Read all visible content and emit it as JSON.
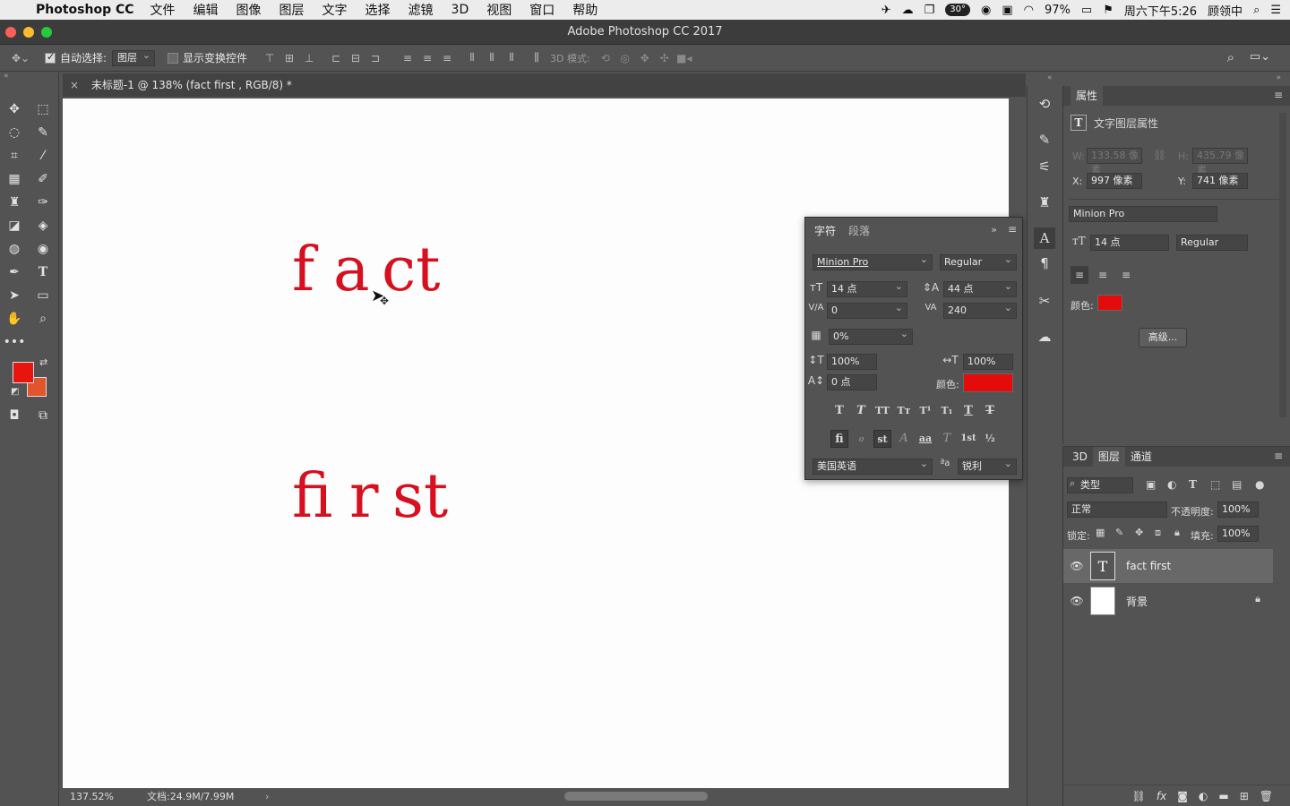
{
  "menubar": {
    "app_name": "Photoshop CC",
    "items": [
      "文件",
      "编辑",
      "图像",
      "图层",
      "文字",
      "选择",
      "滤镜",
      "3D",
      "视图",
      "窗口",
      "帮助"
    ],
    "temperature": "30°",
    "battery": "97%",
    "clock": "周六下午5:26",
    "user": "顾领中"
  },
  "window": {
    "title": "Adobe Photoshop CC 2017"
  },
  "options_bar": {
    "auto_select_label": "自动选择:",
    "auto_select_target": "图层",
    "show_transform_label": "显示变换控件",
    "mode_3d_label": "3D 模式:"
  },
  "document": {
    "tab_title": "未标题-1 @ 138% (fact first , RGB/8) *",
    "glyphs_line1": [
      "f",
      "a",
      "ct"
    ],
    "glyphs_line2": [
      "fi",
      "r",
      "st"
    ],
    "zoom": "137.52%",
    "doc_size": "文档:24.9M/7.99M"
  },
  "colors": {
    "foreground": "#e8150e",
    "background": "#e0552b",
    "text_color": "#e40b0b"
  },
  "properties_panel": {
    "tab": "属性",
    "section_title": "文字图层属性",
    "w_label": "W:",
    "w_value": "133.58 像素",
    "h_label": "H:",
    "h_value": "435.79 像素",
    "x_label": "X:",
    "x_value": "997 像素",
    "y_label": "Y:",
    "y_value": "741 像素",
    "font": "Minion Pro",
    "size": "14 点",
    "style": "Regular",
    "color_label": "颜色:",
    "advanced_button": "高级..."
  },
  "layers_panel": {
    "tabs": [
      "3D",
      "图层",
      "通道"
    ],
    "active_tab": "图层",
    "filter": "类型",
    "blend_mode": "正常",
    "opacity_label": "不透明度:",
    "opacity": "100%",
    "lock_label": "锁定:",
    "fill_label": "填充:",
    "fill": "100%",
    "layers": [
      {
        "name": "fact first",
        "type": "text",
        "selected": true
      },
      {
        "name": "背景",
        "type": "background",
        "locked": true
      }
    ]
  },
  "character_panel": {
    "tabs": [
      "字符",
      "段落"
    ],
    "font": "Minion Pro",
    "style": "Regular",
    "size": "14 点",
    "leading": "44 点",
    "kerning": "0",
    "tracking": "240",
    "tsume": "0%",
    "vscale": "100%",
    "hscale": "100%",
    "baseline": "0 点",
    "color_label": "颜色:",
    "language": "美国英语",
    "antialias": "锐利",
    "type_buttons": [
      "T",
      "T",
      "TT",
      "Tт",
      "T¹",
      "T₁",
      "T",
      "T"
    ],
    "opentype_buttons": [
      "ﬁ",
      "ℴ",
      "st",
      "A",
      "aa",
      "T",
      "1st",
      "½"
    ]
  }
}
